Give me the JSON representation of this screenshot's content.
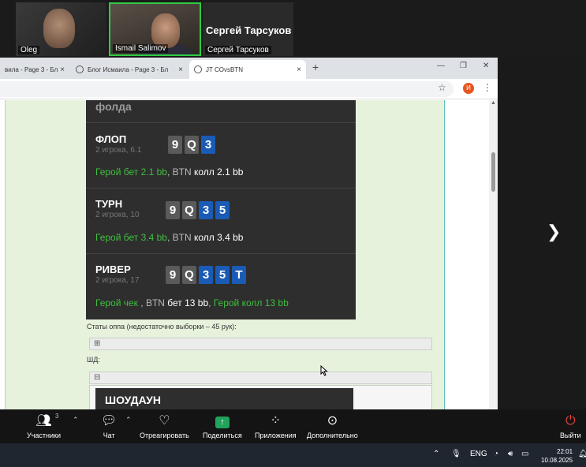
{
  "video": {
    "tile1_name": "Oleg",
    "tile2_name": "Ismail Salimov",
    "tile3_big_name": "Сергей Тарсуков",
    "tile3_name": "Сергей Тарсуков"
  },
  "browser": {
    "tabs": [
      {
        "label": "вила - Page 3 - Бл"
      },
      {
        "label": "Блог Исмаила - Page 3 - Бл"
      },
      {
        "label": "JT COvsBTN"
      }
    ],
    "profile_letter": "И"
  },
  "hand": {
    "fold_text": "фолда",
    "streets": [
      {
        "title": "ФЛОП",
        "sub": "2 игрока, 6.1",
        "cards": [
          {
            "r": "9",
            "c": "g"
          },
          {
            "r": "Q",
            "c": "g"
          },
          {
            "r": "3",
            "c": "b"
          }
        ],
        "action_hero": "Герой бет 2.1 bb",
        "action_rest_a": ", BTN ",
        "action_white": "колл 2.1 bb",
        "action_rest_b": "",
        "action_hero2": ""
      },
      {
        "title": "ТУРН",
        "sub": "2 игрока, 10",
        "cards": [
          {
            "r": "9",
            "c": "g"
          },
          {
            "r": "Q",
            "c": "g"
          },
          {
            "r": "3",
            "c": "b"
          },
          {
            "r": "5",
            "c": "b"
          }
        ],
        "action_hero": "Герой бет 3.4 bb",
        "action_rest_a": ", BTN ",
        "action_white": "колл 3.4 bb",
        "action_rest_b": "",
        "action_hero2": ""
      },
      {
        "title": "РИВЕР",
        "sub": "2 игрока, 17",
        "cards": [
          {
            "r": "9",
            "c": "g"
          },
          {
            "r": "Q",
            "c": "g"
          },
          {
            "r": "3",
            "c": "b"
          },
          {
            "r": "5",
            "c": "b"
          },
          {
            "r": "T",
            "c": "b"
          }
        ],
        "action_hero": "Герой чек",
        "action_rest_a": " , BTN ",
        "action_white": "бет 13 bb",
        "action_rest_b": ", ",
        "action_hero2": "Герой колл 13 bb"
      }
    ]
  },
  "below": {
    "stats_text": "Статы оппа (недостаточно выборки – 45 рук):",
    "expand_symbol": "⊞",
    "sd_label": "ШД:",
    "collapse_symbol": "⊟",
    "showdown_title": "ШОУДАУН"
  },
  "toolbar": {
    "participants_label": "Участники",
    "participants_count": "3",
    "chat_label": "Чат",
    "react_label": "Отреагировать",
    "share_label": "Поделиться",
    "apps_label": "Приложения",
    "more_label": "Дополнительно",
    "leave_label": "Выйти"
  },
  "taskbar": {
    "lang": "ENG",
    "time": "22:01",
    "date": "10.08.2025"
  }
}
